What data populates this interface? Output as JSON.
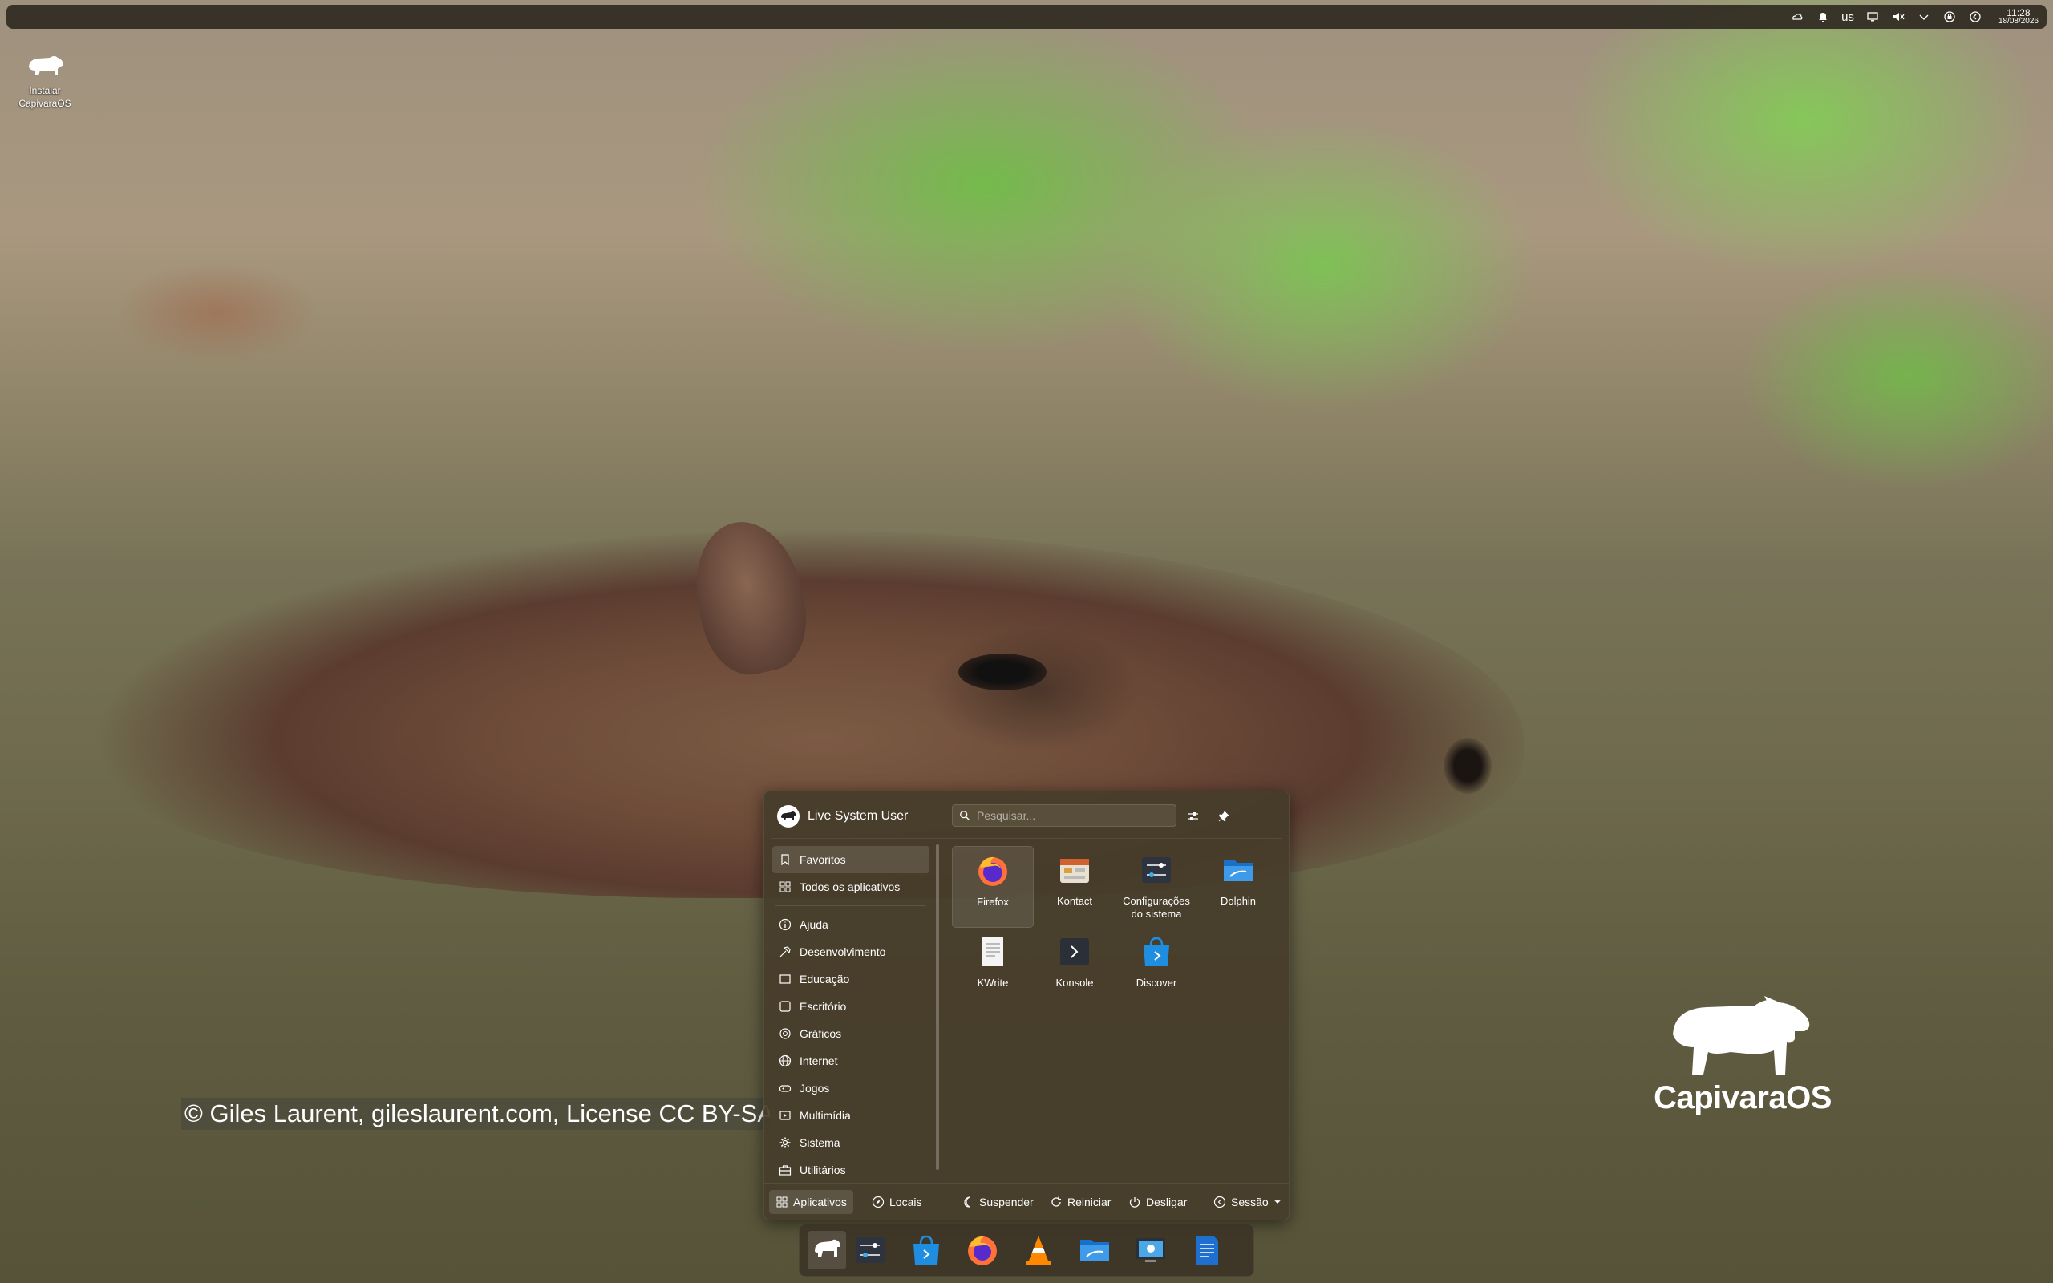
{
  "desktop": {
    "icon_label_line1": "Instalar",
    "icon_label_line2": "CapivaraOS",
    "credit": "© Giles Laurent, gileslaurent.com, License CC BY-SA",
    "brand": "CapivaraOS"
  },
  "panel": {
    "keyboard_layout": "us",
    "time": "11:28",
    "date": "18/08/2026",
    "tray_icons": [
      "weather-icon",
      "notifications-icon",
      "keyboard-layout",
      "display-icon",
      "volume-muted-icon",
      "tray-expand-icon",
      "vpn-icon",
      "clock-icon"
    ]
  },
  "launcher": {
    "user_name": "Live System User",
    "search_placeholder": "Pesquisar...",
    "categories": [
      {
        "label": "Favoritos",
        "icon": "bookmark-icon"
      },
      {
        "label": "Todos os aplicativos",
        "icon": "grid-icon"
      },
      {
        "label": "Ajuda",
        "icon": "help-icon"
      },
      {
        "label": "Desenvolvimento",
        "icon": "hammer-icon"
      },
      {
        "label": "Educação",
        "icon": "education-icon"
      },
      {
        "label": "Escritório",
        "icon": "office-icon"
      },
      {
        "label": "Gráficos",
        "icon": "graphics-icon"
      },
      {
        "label": "Internet",
        "icon": "globe-icon"
      },
      {
        "label": "Jogos",
        "icon": "gamepad-icon"
      },
      {
        "label": "Multimídia",
        "icon": "multimedia-icon"
      },
      {
        "label": "Sistema",
        "icon": "gear-icon"
      },
      {
        "label": "Utilitários",
        "icon": "toolbox-icon"
      }
    ],
    "apps": [
      {
        "label": "Firefox",
        "icon": "firefox-icon"
      },
      {
        "label": "Kontact",
        "icon": "kontact-icon"
      },
      {
        "label_line1": "Configurações",
        "label_line2": "do sistema",
        "icon": "system-settings-icon"
      },
      {
        "label": "Dolphin",
        "icon": "dolphin-icon"
      },
      {
        "label": "KWrite",
        "icon": "kwrite-icon"
      },
      {
        "label": "Konsole",
        "icon": "konsole-icon"
      },
      {
        "label": "Discover",
        "icon": "discover-icon"
      }
    ],
    "footer": {
      "applications": "Aplicativos",
      "places": "Locais",
      "suspend": "Suspender",
      "restart": "Reiniciar",
      "shutdown": "Desligar",
      "session": "Sessão"
    }
  },
  "dock": {
    "items": [
      "capivara-launcher-icon",
      "system-settings-icon",
      "discover-icon",
      "firefox-icon",
      "vlc-icon",
      "dolphin-icon",
      "screenshot-icon",
      "office-writer-icon"
    ]
  },
  "colors": {
    "launcher_bg": "#463c2a",
    "accent": "#3d8fe0"
  }
}
